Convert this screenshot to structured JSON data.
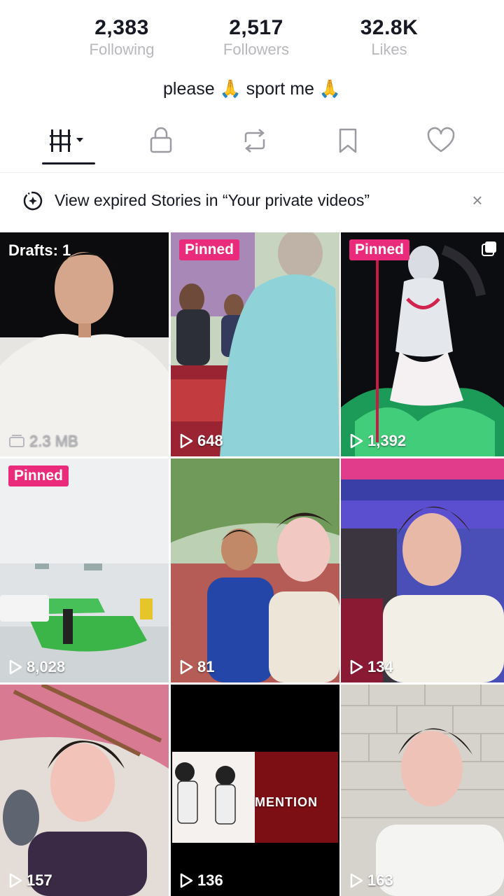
{
  "profile": {
    "stats": [
      {
        "value": "2,383",
        "label": "Following"
      },
      {
        "value": "2,517",
        "label": "Followers"
      },
      {
        "value": "32.8K",
        "label": "Likes"
      }
    ],
    "bio": "please 🙏 sport me 🙏"
  },
  "tabs": [
    {
      "icon": "videos-grid-icon",
      "active": true
    },
    {
      "icon": "lock-icon",
      "active": false
    },
    {
      "icon": "repost-icon",
      "active": false
    },
    {
      "icon": "bookmark-icon",
      "active": false
    },
    {
      "icon": "heart-icon",
      "active": false
    }
  ],
  "banner": {
    "icon": "stories-add-icon",
    "text": "View expired Stories in “Your private videos”",
    "close": "×"
  },
  "videos": [
    {
      "label": "Drafts: 1",
      "meta": "2.3 MB",
      "meta_icon": "drafts-storage-icon"
    },
    {
      "badge": "Pinned",
      "views": "648",
      "meta_icon": "play-icon"
    },
    {
      "badge": "Pinned",
      "views": "1,392",
      "meta_icon": "play-icon",
      "corner_icon": "multi-photo-icon"
    },
    {
      "badge": "Pinned",
      "views": "8,028",
      "meta_icon": "play-icon"
    },
    {
      "views": "81",
      "meta_icon": "play-icon"
    },
    {
      "views": "134",
      "meta_icon": "play-icon"
    },
    {
      "views": "157",
      "meta_icon": "play-icon"
    },
    {
      "views": "136",
      "meta_icon": "play-icon",
      "overlay_text": "MENTION"
    },
    {
      "views": "163",
      "meta_icon": "play-icon"
    }
  ],
  "colors": {
    "pinned_badge": "#ea2a7a",
    "text_primary": "#161823",
    "text_secondary": "#b8b8bd"
  }
}
